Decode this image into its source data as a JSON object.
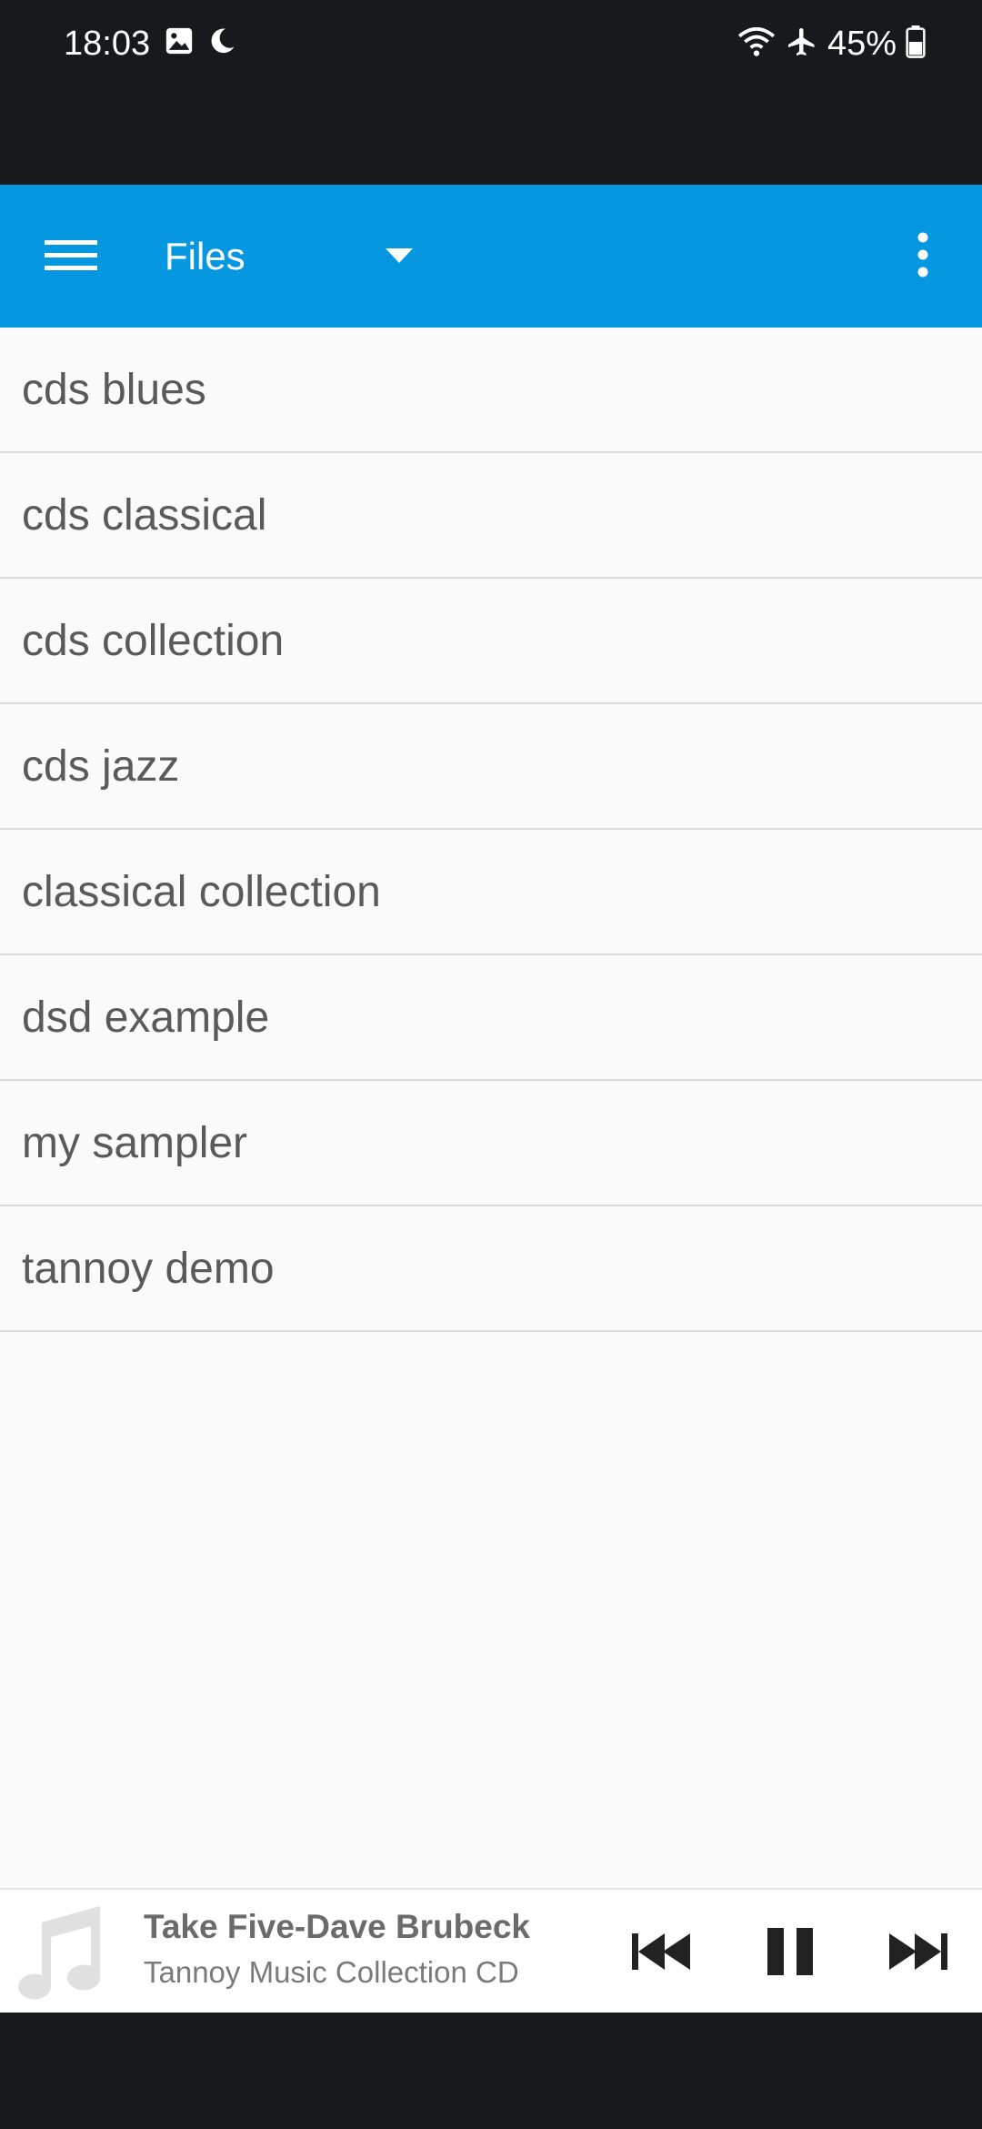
{
  "status_bar": {
    "time": "18:03",
    "battery": "45%",
    "left_icons": [
      "gallery-icon",
      "moon-icon"
    ],
    "right_icons": [
      "wifi-icon",
      "airplane-icon",
      "battery-icon"
    ]
  },
  "app_bar": {
    "title": "Files",
    "background": "#0598e0",
    "icons": [
      "menu-icon",
      "dropdown-caret-icon",
      "more-vert-icon"
    ]
  },
  "list": {
    "items": [
      {
        "label": "cds blues"
      },
      {
        "label": "cds classical"
      },
      {
        "label": "cds collection"
      },
      {
        "label": "cds jazz"
      },
      {
        "label": "classical collection"
      },
      {
        "label": "dsd example"
      },
      {
        "label": "my sampler"
      },
      {
        "label": "tannoy demo"
      }
    ]
  },
  "now_playing": {
    "title": "Take Five-Dave Brubeck",
    "album": "Tannoy Music Collection CD",
    "icons": [
      "music-note-icon",
      "skip-previous-icon",
      "pause-icon",
      "skip-next-icon"
    ]
  }
}
